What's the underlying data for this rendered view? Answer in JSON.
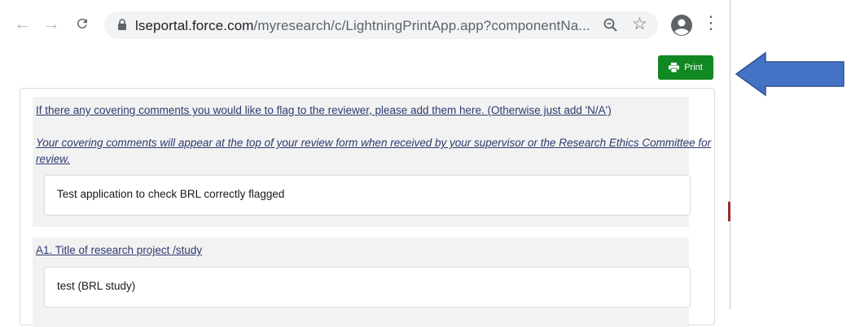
{
  "browser": {
    "url_host": "lseportal.force.com",
    "url_path": "/myresearch/c/LightningPrintApp.app?componentNa...",
    "icons": [
      "back-arrow",
      "forward-arrow",
      "reload",
      "lock",
      "zoom-magnifier",
      "bookmark-star",
      "profile-avatar",
      "kebab-menu"
    ]
  },
  "toolbar": {
    "print_label": "Print"
  },
  "form": {
    "question1_label": "If there any covering comments you would like to flag to the reviewer, please add them here. (Otherwise just add 'N/A')",
    "question1_note": "Your covering comments will appear at the top of your review form when received by your supervisor or the Research Ethics Committee for review.",
    "question1_answer": "Test application to check BRL correctly flagged",
    "question2_label": "A1. Title of research project /study",
    "question2_answer": "test (BRL study)"
  },
  "annotation": {
    "arrow_color": "#4472c4"
  },
  "colors": {
    "print_button": "#118821",
    "label_text": "#2d3a6e",
    "section_bg": "#f3f2f2"
  }
}
